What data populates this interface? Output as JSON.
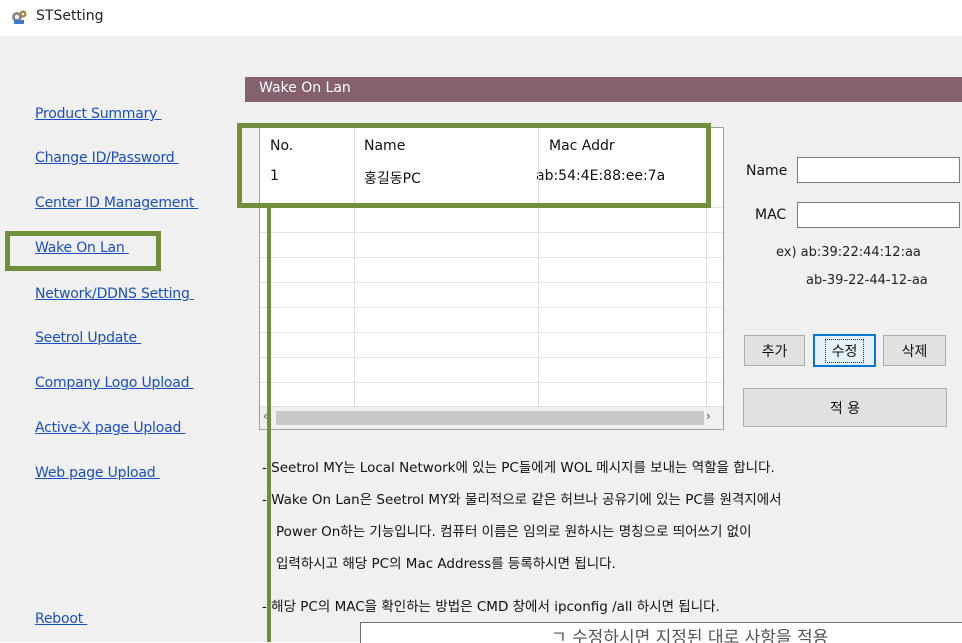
{
  "window": {
    "title": "STSetting",
    "icon": "gear-icon"
  },
  "sidebar": {
    "items": [
      {
        "label": "Product Summary "
      },
      {
        "label": "Change ID/Password "
      },
      {
        "label": "Center ID Management "
      },
      {
        "label": "Wake On Lan "
      },
      {
        "label": "Network/DDNS Setting "
      },
      {
        "label": "Seetrol Update "
      },
      {
        "label": "Company Logo Upload "
      },
      {
        "label": "Active-X page Upload "
      },
      {
        "label": "Web page Upload "
      }
    ],
    "reboot": "Reboot "
  },
  "panel": {
    "title": "Wake On Lan"
  },
  "table": {
    "columns": [
      "No.",
      "Name",
      "Mac Addr"
    ],
    "rows": [
      {
        "no": "1",
        "name": "홍길동PC",
        "mac": "ab:54:4E:88:ee:7a"
      }
    ]
  },
  "form": {
    "name_label": "Name",
    "mac_label": "MAC",
    "name_value": "",
    "mac_value": "",
    "hint_line1": "ex) ab:39:22:44:12:aa",
    "hint_line2": "ab-39-22-44-12-aa"
  },
  "buttons": {
    "add": "추가",
    "edit": "수정",
    "delete": "삭제",
    "apply": "적 용"
  },
  "description": {
    "line1": "- Seetrol MY는 Local Network에 있는 PC들에게 WOL 메시지를 보내는 역할을 합니다.",
    "line2": "- Wake On Lan은 Seetrol MY와 물리적으로 같은 허브나 공유기에 있는 PC를 원격지에서",
    "line3": "Power On하는 기능입니다. 컴퓨터 이름은 임의로 원하시는 명칭으로 띄어쓰기 없이",
    "line4": "입력하시고 해당 PC의 Mac Address를 등록하시면 됩니다.",
    "line5": "- 해당 PC의 MAC을 확인하는 방법은 CMD 창에서 ipconfig /all 하시면 됩니다."
  },
  "bottom_box": {
    "text": "ㄱ 수정하시면 지정된 대로 사항을 적용"
  },
  "colors": {
    "panel_header": "#85606e",
    "link": "#1a4fc4",
    "highlight": "#6f8f3d"
  }
}
